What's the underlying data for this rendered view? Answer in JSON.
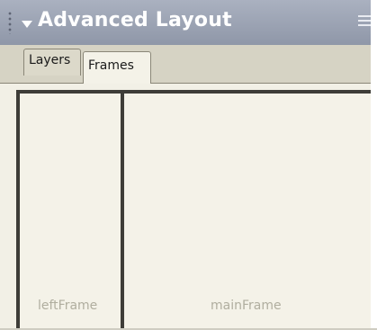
{
  "panel": {
    "title": "Advanced Layout",
    "tabs": [
      {
        "label": "Layers",
        "selected": false
      },
      {
        "label": "Frames",
        "selected": true
      }
    ],
    "icons": {
      "grip": "grip-dots-icon",
      "collapse": "triangle-down-icon",
      "options": "options-menu-icon"
    }
  },
  "frames": [
    {
      "label": "leftFrame"
    },
    {
      "label": "mainFrame"
    }
  ],
  "colors": {
    "title_bar": "#9aa1b1",
    "panel_bg": "#f2f0e6",
    "frame_border": "#3e3d38",
    "frame_label": "#b0ae9f"
  }
}
